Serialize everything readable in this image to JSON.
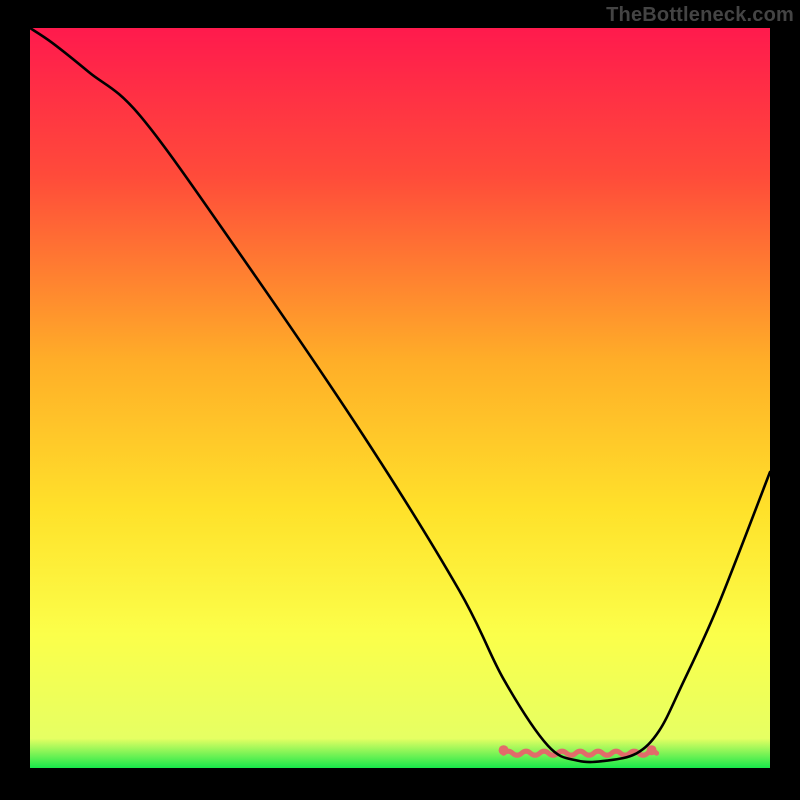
{
  "watermark": "TheBottleneck.com",
  "chart_data": {
    "type": "line",
    "title": "",
    "xlabel": "",
    "ylabel": "",
    "xlim": [
      0,
      100
    ],
    "ylim": [
      0,
      100
    ],
    "background": {
      "type": "vertical-gradient",
      "stops": [
        {
          "offset": 0.0,
          "color": "#ff1a4d"
        },
        {
          "offset": 0.2,
          "color": "#ff4b3a"
        },
        {
          "offset": 0.45,
          "color": "#ffae28"
        },
        {
          "offset": 0.65,
          "color": "#ffe12a"
        },
        {
          "offset": 0.82,
          "color": "#fbff4a"
        },
        {
          "offset": 0.96,
          "color": "#e6ff63"
        },
        {
          "offset": 1.0,
          "color": "#17e84a"
        }
      ]
    },
    "series": [
      {
        "name": "bottleneck-curve",
        "color": "#000000",
        "x": [
          0,
          3,
          8,
          15,
          28,
          45,
          58,
          64,
          70,
          74,
          78,
          82,
          85,
          88,
          93,
          100
        ],
        "y": [
          100,
          98,
          94,
          88,
          70,
          45,
          24,
          12,
          3,
          1,
          1,
          2,
          5,
          11,
          22,
          40
        ]
      }
    ],
    "flat_zone_highlight": {
      "name": "optimal-range",
      "color": "#e26b6a",
      "x_start": 64,
      "x_end": 84,
      "y_level": 2
    },
    "annotations": []
  }
}
